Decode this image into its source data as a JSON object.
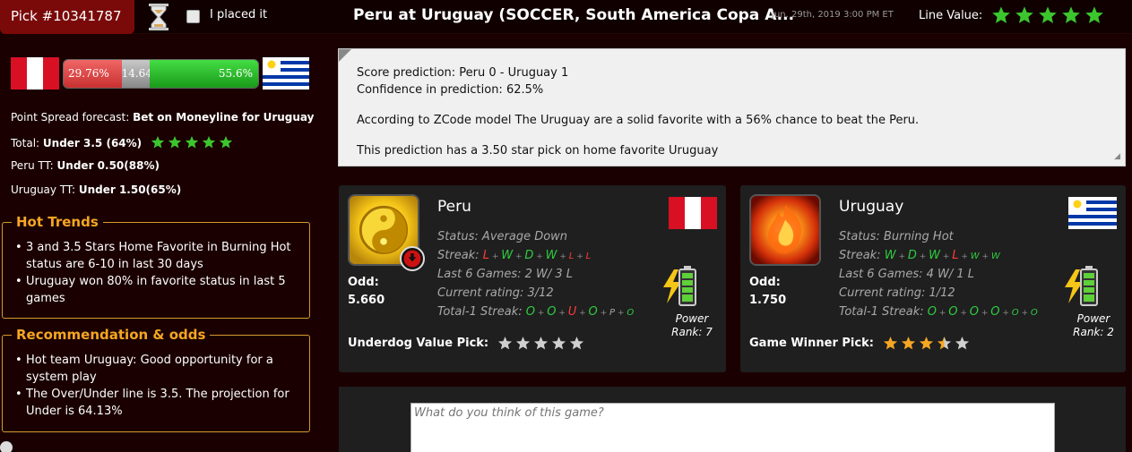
{
  "header": {
    "pick_id": "Pick #10341787",
    "placed_label": "I placed it",
    "game_title": "Peru at Uruguay (SOCCER, South America Copa A...",
    "date": "Jun. 29th, 2019 3:00 PM ET",
    "line_value_label": "Line Value:",
    "line_value_stars": 5
  },
  "probability_bar": {
    "away_pct": "29.76%",
    "draw_pct": "14.64%",
    "home_pct": "55.6%",
    "away_value": 29.76,
    "draw_value": 14.64,
    "home_value": 55.6
  },
  "forecast": {
    "spread_label": "Point Spread forecast:",
    "spread_value": "Bet on Moneyline for Uruguay",
    "total_label": "Total:",
    "total_value": "Under 3.5 (64%)",
    "total_stars": 5,
    "peru_tt_label": "Peru TT:",
    "peru_tt_value": "Under 0.50(88%)",
    "uruguay_tt_label": "Uruguay TT:",
    "uruguay_tt_value": "Under 1.50(65%)"
  },
  "hot_trends": {
    "title": "Hot Trends",
    "items": [
      "3 and 3.5 Stars Home Favorite in Burning Hot status are 6-10 in last 30 days",
      "Uruguay won 80% in favorite status in last 5 games"
    ]
  },
  "recommendation": {
    "title": "Recommendation & odds",
    "items": [
      "Hot team Uruguay: Good opportunity for a system play",
      "The Over/Under line is 3.5. The projection for Under is 64.13%"
    ]
  },
  "prediction": {
    "score": "Score prediction: Peru 0 - Uruguay 1",
    "confidence": "Confidence in prediction: 62.5%",
    "model": "According to ZCode model The Uruguay are a solid favorite with a 56% chance to beat the Peru.",
    "star_pick": "This prediction has a 3.50 star pick on home favorite Uruguay"
  },
  "peru": {
    "name": "Peru",
    "status": "Status: Average Down",
    "streak_label": "Streak:",
    "streak": [
      "L",
      "W",
      "D",
      "W",
      "L",
      "L"
    ],
    "last6": "Last 6 Games: 2 W/ 3 L",
    "rating": "Current rating: 3/12",
    "total_label": "Total-1 Streak:",
    "total_streak": [
      "O",
      "O",
      "U",
      "O",
      "P",
      "O"
    ],
    "odd_label": "Odd:",
    "odd_value": "5.660",
    "power_label": "Power",
    "power_rank": "Rank: 7",
    "pick_label": "Underdog Value Pick:",
    "pick_stars": 0
  },
  "uruguay": {
    "name": "Uruguay",
    "status": "Status: Burning Hot",
    "streak_label": "Streak:",
    "streak": [
      "W",
      "D",
      "W",
      "L",
      "W",
      "W"
    ],
    "last6": "Last 6 Games: 4 W/ 1 L",
    "rating": "Current rating: 1/12",
    "total_label": "Total-1 Streak:",
    "total_streak": [
      "O",
      "O",
      "O",
      "O",
      "O",
      "O"
    ],
    "odd_label": "Odd:",
    "odd_value": "1.750",
    "power_label": "Power",
    "power_rank": "Rank: 2",
    "pick_label": "Game Winner Pick:",
    "pick_stars": 3.5
  },
  "comment": {
    "placeholder": "What do you think of this game?"
  },
  "colors": {
    "accent_orange": "#f5a623",
    "win_green": "#2ecc40",
    "loss_red": "#ff3b3b",
    "pick_red": "#7a0a0a"
  }
}
